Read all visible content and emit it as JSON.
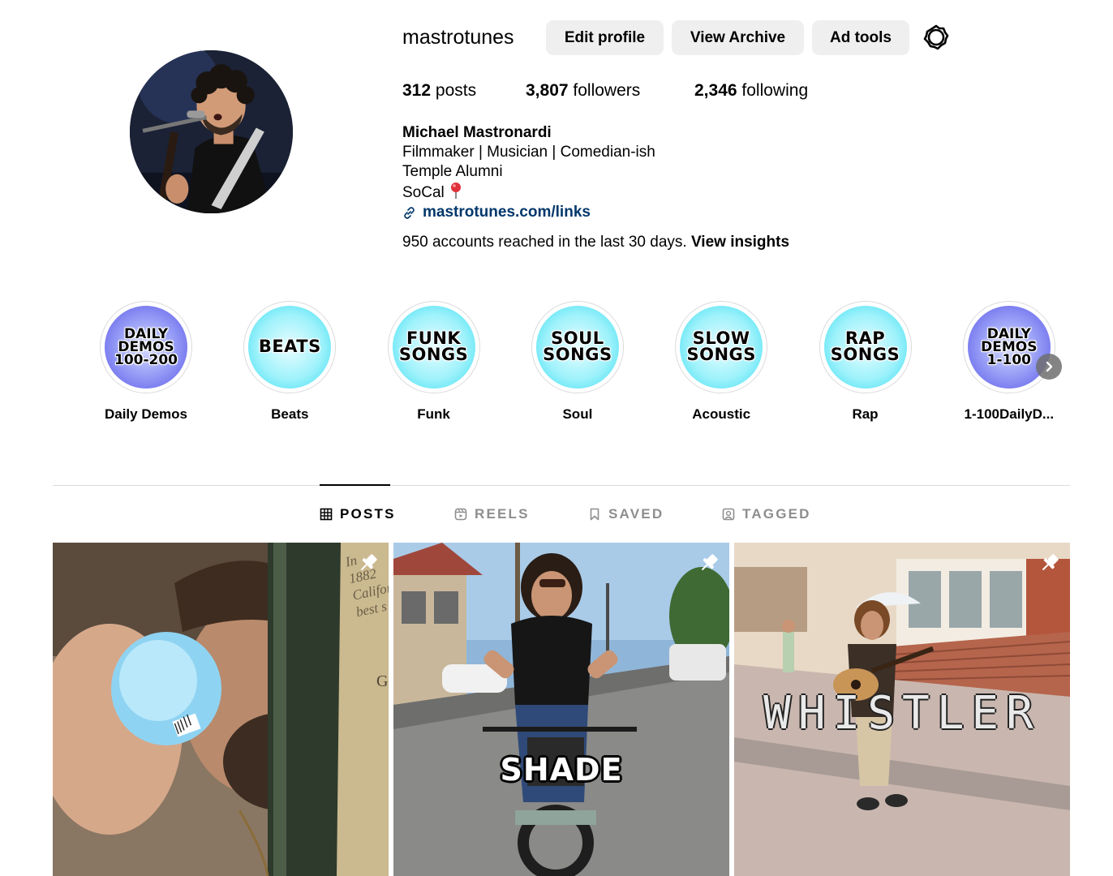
{
  "profile": {
    "username": "mastrotunes",
    "buttons": {
      "edit": "Edit profile",
      "archive": "View Archive",
      "ad_tools": "Ad tools"
    },
    "stats": {
      "posts_count": "312",
      "posts_label": "posts",
      "followers_count": "3,807",
      "followers_label": "followers",
      "following_count": "2,346",
      "following_label": "following"
    },
    "bio": {
      "name": "Michael Mastronardi",
      "line1": "Filmmaker | Musician | Comedian-ish",
      "line2": "Temple Alumni",
      "line3": "SoCal",
      "link": "mastrotunes.com/links"
    },
    "insights": {
      "text": "950 accounts reached in the last 30 days.",
      "link": "View insights"
    }
  },
  "highlights": [
    {
      "cover": "DAILY\nDEMOS\n100-200",
      "label": "Daily Demos",
      "style": "purple"
    },
    {
      "cover": "BEATS",
      "label": "Beats",
      "style": "cyan"
    },
    {
      "cover": "FUNK\nSONGS",
      "label": "Funk",
      "style": "cyan"
    },
    {
      "cover": "SOUL\nSONGS",
      "label": "Soul",
      "style": "cyan"
    },
    {
      "cover": "SLOW\nSONGS",
      "label": "Acoustic",
      "style": "cyan"
    },
    {
      "cover": "RAP\nSONGS",
      "label": "Rap",
      "style": "cyan"
    },
    {
      "cover": "DAILY\nDEMOS\n1-100",
      "label": "1-100DailyD...",
      "style": "purple"
    }
  ],
  "tabs": {
    "posts": "POSTS",
    "reels": "REELS",
    "saved": "SAVED",
    "tagged": "TAGGED"
  },
  "posts": {
    "p1": {
      "sign_text": "In 1882\nCalifor\nbest s",
      "sign_bottom": "GC"
    },
    "p2": {
      "caption": "SHADE"
    },
    "p3": {
      "caption": "WHISTLER"
    }
  },
  "colors": {
    "link": "#00376b",
    "button_bg": "#efefef",
    "tab_inactive": "#8e8e8e",
    "divider": "#dbdbdb"
  }
}
